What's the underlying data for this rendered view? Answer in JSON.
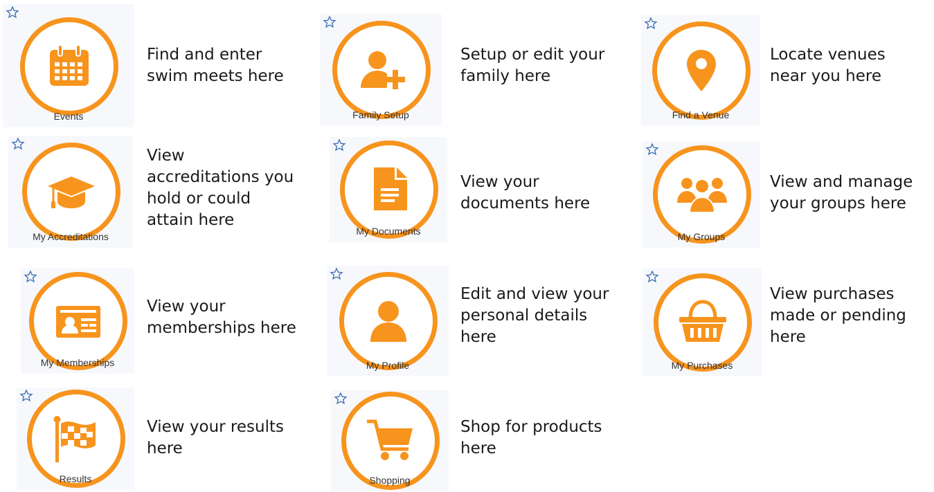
{
  "colors": {
    "accent": "#f7941d",
    "star": "#3b6db3",
    "tile_bg": "#f6f8fc"
  },
  "apps": [
    {
      "label": "Events",
      "icon": "calendar-icon",
      "description": "Find and enter\nswim meets here"
    },
    {
      "label": "Family Setup",
      "icon": "add-user-icon",
      "description": "Setup or edit your\nfamily here"
    },
    {
      "label": "Find a Venue",
      "icon": "map-pin-icon",
      "description": "Locate venues\nnear you here"
    },
    {
      "label": "My Accreditations",
      "icon": "graduation-cap-icon",
      "description": "View\naccreditations you\nhold or could\nattain here"
    },
    {
      "label": "My Documents",
      "icon": "document-icon",
      "description": "View your\ndocuments here"
    },
    {
      "label": "My Groups",
      "icon": "users-group-icon",
      "description": "View and manage\nyour groups here"
    },
    {
      "label": "My Memberships",
      "icon": "id-card-icon",
      "description": "View your\nmemberships here"
    },
    {
      "label": "My Profile",
      "icon": "user-icon",
      "description": "Edit and view your\npersonal details\nhere"
    },
    {
      "label": "My Purchases",
      "icon": "shopping-basket-icon",
      "description": "View purchases\nmade or pending\nhere"
    },
    {
      "label": "Results",
      "icon": "checkered-flag-icon",
      "description": "View your results\nhere"
    },
    {
      "label": "Shopping",
      "icon": "shopping-cart-icon",
      "description": "Shop for products\nhere"
    }
  ]
}
